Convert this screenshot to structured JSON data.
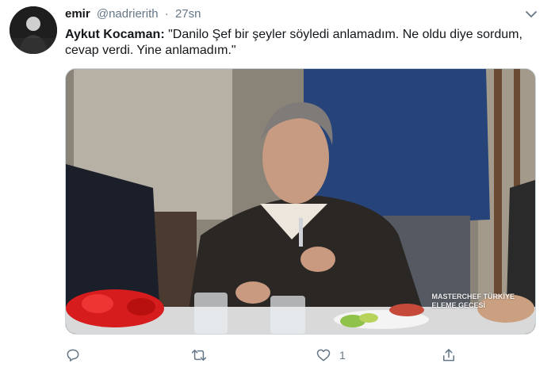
{
  "tweet": {
    "display_name": "emir",
    "handle": "@nadrierith",
    "separator": "·",
    "timestamp": "27sn",
    "speaker": "Aykut Kocaman:",
    "quote": "\"Danilo Şef bir şeyler söyledi anlamadım. Ne oldu diye sordum, cevap verdi. Yine anlamadım.\"",
    "media": {
      "watermark_line1": "MASTERCHEF TÜRKİYE",
      "watermark_line2": "ELEME GECESİ"
    }
  },
  "actions": {
    "reply_icon": "reply-icon",
    "retweet_icon": "retweet-icon",
    "like_icon": "heart-icon",
    "like_count": "1",
    "share_icon": "share-icon"
  },
  "colors": {
    "text_primary": "#14171a",
    "text_secondary": "#657786",
    "border": "#ccd6dd"
  }
}
